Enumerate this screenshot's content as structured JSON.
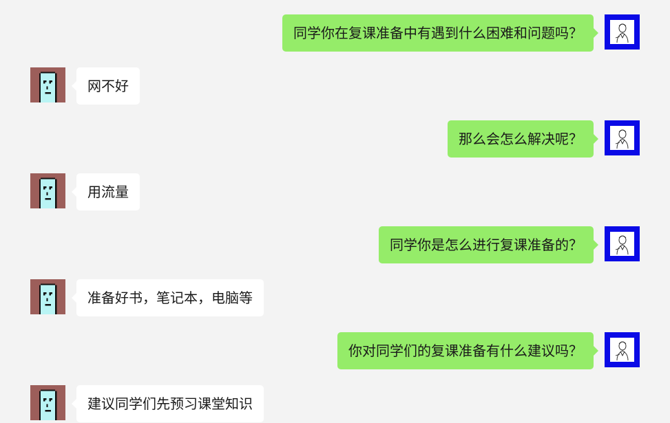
{
  "chat": {
    "messages": [
      {
        "sender": "self",
        "text": "同学你在复课准备中有遇到什么困难和问题吗？",
        "avatar_icon": "sketch-person-avatar-icon"
      },
      {
        "sender": "other",
        "text": "网不好",
        "avatar_icon": "pixel-face-avatar-icon"
      },
      {
        "sender": "self",
        "text": "那么会怎么解决呢？",
        "avatar_icon": "sketch-person-avatar-icon"
      },
      {
        "sender": "other",
        "text": "用流量",
        "avatar_icon": "pixel-face-avatar-icon"
      },
      {
        "sender": "self",
        "text": "同学你是怎么进行复课准备的？",
        "avatar_icon": "sketch-person-avatar-icon"
      },
      {
        "sender": "other",
        "text": "准备好书，笔记本，电脑等",
        "avatar_icon": "pixel-face-avatar-icon"
      },
      {
        "sender": "self",
        "text": "你对同学们的复课准备有什么建议吗？",
        "avatar_icon": "sketch-person-avatar-icon"
      },
      {
        "sender": "other",
        "text": "建议同学们先预习课堂知识",
        "avatar_icon": "pixel-face-avatar-icon"
      }
    ]
  },
  "colors": {
    "background": "#f3f3f3",
    "self_bubble": "#95ec69",
    "other_bubble": "#ffffff",
    "self_avatar_border": "#0a0ae6",
    "other_avatar_bg": "#9c5e5a",
    "other_avatar_face": "#b9f4f4"
  }
}
